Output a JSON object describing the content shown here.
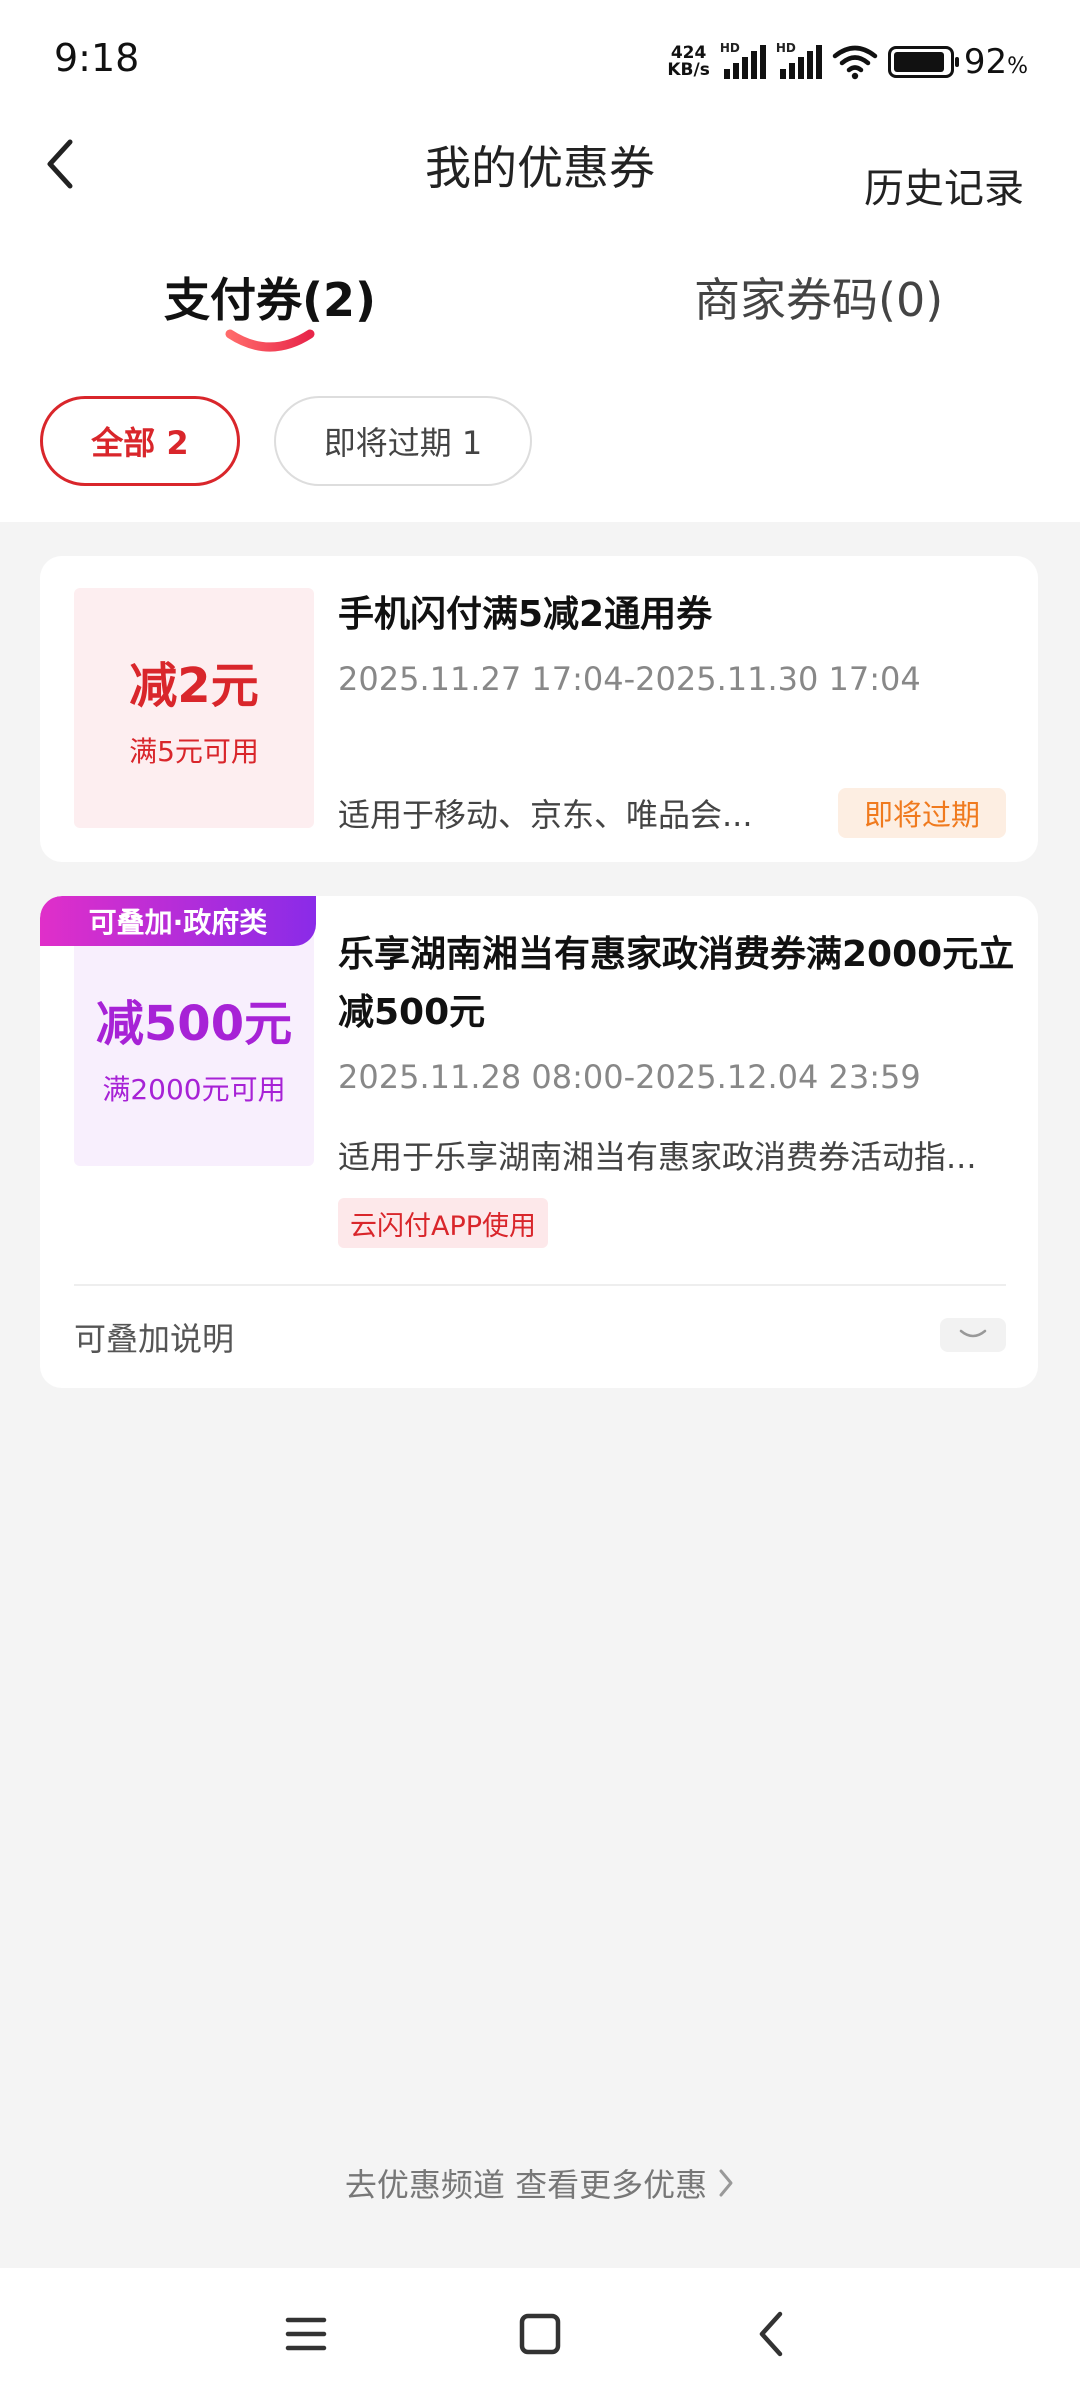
{
  "status_bar": {
    "time": "9:18",
    "net_speed_value": "424",
    "net_speed_unit": "KB/s",
    "signal_label": "HD",
    "battery_value": "92",
    "battery_unit": "%"
  },
  "header": {
    "title": "我的优惠券",
    "history": "历史记录"
  },
  "tabs": [
    {
      "label": "支付券(2)",
      "active": true
    },
    {
      "label": "商家券码(0)",
      "active": false
    }
  ],
  "filters": [
    {
      "label": "全部 2",
      "active": true
    },
    {
      "label": "即将过期 1",
      "active": false
    }
  ],
  "coupons": [
    {
      "amount": "减2元",
      "condition": "满5元可用",
      "title": "手机闪付满5减2通用券",
      "validity": "2025.11.27 17:04-2025.11.30 17:04",
      "description": "适用于移动、京东、唯品会...",
      "status_tag": "即将过期",
      "accent_color": "#d9262b"
    },
    {
      "badge": "可叠加·政府类",
      "amount": "减500元",
      "condition": "满2000元可用",
      "title": "乐享湖南湘当有惠家政消费券满2000元立减500元",
      "validity": "2025.11.28 08:00-2025.12.04 23:59",
      "description": "适用于乐享湖南湘当有惠家政消费券活动指...",
      "channel_tag": "云闪付APP使用",
      "stack_note": "可叠加说明",
      "accent_color": "#a722d6"
    }
  ],
  "footer_link": "去优惠频道 查看更多优惠",
  "icons": {
    "back": "back-chevron-icon",
    "wifi": "wifi-icon",
    "battery": "battery-icon",
    "expand": "chevron-down-icon",
    "nav_menu": "menu-icon",
    "nav_home": "home-square-icon",
    "nav_back": "nav-back-icon"
  }
}
